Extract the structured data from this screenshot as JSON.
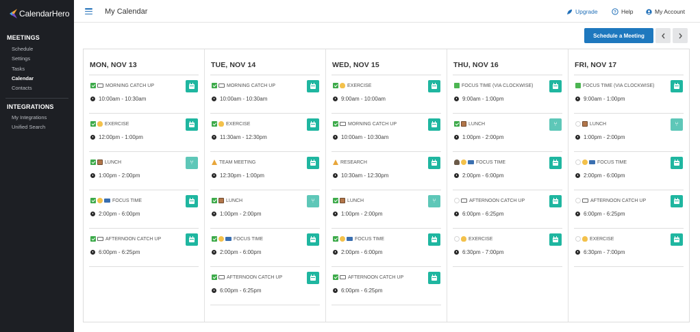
{
  "app": {
    "name": "CalendarHero"
  },
  "sidebar": {
    "sections": [
      {
        "title": "MEETINGS",
        "items": [
          {
            "label": "Schedule",
            "active": false
          },
          {
            "label": "Settings",
            "active": false
          },
          {
            "label": "Tasks",
            "active": false
          },
          {
            "label": "Calendar",
            "active": true
          },
          {
            "label": "Contacts",
            "active": false
          }
        ]
      },
      {
        "title": "INTEGRATIONS",
        "items": [
          {
            "label": "My Integrations",
            "active": false
          },
          {
            "label": "Unified Search",
            "active": false
          }
        ]
      }
    ]
  },
  "header": {
    "title": "My Calendar",
    "upgrade": "Upgrade",
    "help": "Help",
    "account": "My Account"
  },
  "toolbar": {
    "schedule_label": "Schedule a Meeting",
    "prev_icon": "chevron-left-icon",
    "next_icon": "chevron-right-icon"
  },
  "colors": {
    "sidebar_bg": "#1d1f24",
    "primary": "#1e78be",
    "teal": "#1fb6a0",
    "checked": "#3daa4a"
  },
  "days": [
    {
      "label": "MON, NOV 13",
      "events": [
        {
          "title": "MORNING CATCH UP",
          "time": "10:00am - 10:30am",
          "status_icon": "check",
          "emoji_icon": "laptop",
          "action_icon": "calendar"
        },
        {
          "title": "EXERCISE",
          "time": "12:00pm - 1:00pm",
          "status_icon": "check",
          "emoji_icon": "bicep",
          "action_icon": "calendar"
        },
        {
          "title": "LUNCH",
          "time": "1:00pm - 2:00pm",
          "status_icon": "check",
          "emoji_icon": "lunchbox",
          "action_icon": "fork-knife"
        },
        {
          "title": "FOCUS TIME",
          "time": "2:00pm - 6:00pm",
          "status_icon": "check",
          "emoji_icon": "face-computer",
          "action_icon": "calendar"
        },
        {
          "title": "AFTERNOON CATCH UP",
          "time": "6:00pm - 6:25pm",
          "status_icon": "check",
          "emoji_icon": "laptop",
          "action_icon": "calendar"
        }
      ]
    },
    {
      "label": "TUE, NOV 14",
      "events": [
        {
          "title": "MORNING CATCH UP",
          "time": "10:00am - 10:30am",
          "status_icon": "check",
          "emoji_icon": "laptop",
          "action_icon": "calendar"
        },
        {
          "title": "EXERCISE",
          "time": "11:30am - 12:30pm",
          "status_icon": "check",
          "emoji_icon": "bicep",
          "action_icon": "calendar"
        },
        {
          "title": "TEAM MEETING",
          "time": "12:30pm - 1:00pm",
          "status_icon": "none",
          "emoji_icon": "cone",
          "action_icon": "calendar"
        },
        {
          "title": "LUNCH",
          "time": "1:00pm - 2:00pm",
          "status_icon": "check",
          "emoji_icon": "lunchbox",
          "action_icon": "fork-knife"
        },
        {
          "title": "FOCUS TIME",
          "time": "2:00pm - 6:00pm",
          "status_icon": "check",
          "emoji_icon": "face-computer",
          "action_icon": "calendar"
        },
        {
          "title": "AFTERNOON CATCH UP",
          "time": "6:00pm - 6:25pm",
          "status_icon": "check",
          "emoji_icon": "laptop",
          "action_icon": "calendar"
        }
      ]
    },
    {
      "label": "WED, NOV 15",
      "events": [
        {
          "title": "EXERCISE",
          "time": "9:00am - 10:00am",
          "status_icon": "check",
          "emoji_icon": "bicep",
          "action_icon": "calendar"
        },
        {
          "title": "MORNING CATCH UP",
          "time": "10:00am - 10:30am",
          "status_icon": "check",
          "emoji_icon": "laptop",
          "action_icon": "calendar"
        },
        {
          "title": "RESEARCH",
          "time": "10:30am - 12:30pm",
          "status_icon": "none",
          "emoji_icon": "cone",
          "action_icon": "calendar"
        },
        {
          "title": "LUNCH",
          "time": "1:00pm - 2:00pm",
          "status_icon": "check",
          "emoji_icon": "lunchbox",
          "action_icon": "fork-knife"
        },
        {
          "title": "FOCUS TIME",
          "time": "2:00pm - 6:00pm",
          "status_icon": "check",
          "emoji_icon": "face-computer",
          "action_icon": "calendar"
        },
        {
          "title": "AFTERNOON CATCH UP",
          "time": "6:00pm - 6:25pm",
          "status_icon": "check",
          "emoji_icon": "laptop",
          "action_icon": "calendar"
        }
      ]
    },
    {
      "label": "THU, NOV 16",
      "events": [
        {
          "title": "FOCUS TIME (VIA CLOCKWISE)",
          "time": "9:00am - 1:00pm",
          "status_icon": "green-square",
          "emoji_icon": "none",
          "action_icon": "calendar"
        },
        {
          "title": "LUNCH",
          "time": "1:00pm - 2:00pm",
          "status_icon": "check",
          "emoji_icon": "lunchbox",
          "action_icon": "fork-knife"
        },
        {
          "title": "FOCUS TIME",
          "time": "2:00pm - 6:00pm",
          "status_icon": "person",
          "emoji_icon": "face-computer",
          "action_icon": "calendar"
        },
        {
          "title": "AFTERNOON CATCH UP",
          "time": "6:00pm - 6:25pm",
          "status_icon": "circle",
          "emoji_icon": "laptop",
          "action_icon": "calendar"
        },
        {
          "title": "EXERCISE",
          "time": "6:30pm - 7:00pm",
          "status_icon": "circle",
          "emoji_icon": "bicep",
          "action_icon": "calendar"
        }
      ]
    },
    {
      "label": "FRI, NOV 17",
      "events": [
        {
          "title": "FOCUS TIME (VIA CLOCKWISE)",
          "time": "9:00am - 1:00pm",
          "status_icon": "green-square",
          "emoji_icon": "none",
          "action_icon": "calendar"
        },
        {
          "title": "LUNCH",
          "time": "1:00pm - 2:00pm",
          "status_icon": "circle",
          "emoji_icon": "lunchbox",
          "action_icon": "fork-knife"
        },
        {
          "title": "FOCUS TIME",
          "time": "2:00pm - 6:00pm",
          "status_icon": "circle",
          "emoji_icon": "face-computer",
          "action_icon": "calendar"
        },
        {
          "title": "AFTERNOON CATCH UP",
          "time": "6:00pm - 6:25pm",
          "status_icon": "circle",
          "emoji_icon": "laptop",
          "action_icon": "calendar"
        },
        {
          "title": "EXERCISE",
          "time": "6:30pm - 7:00pm",
          "status_icon": "circle",
          "emoji_icon": "bicep",
          "action_icon": "calendar"
        }
      ]
    }
  ]
}
